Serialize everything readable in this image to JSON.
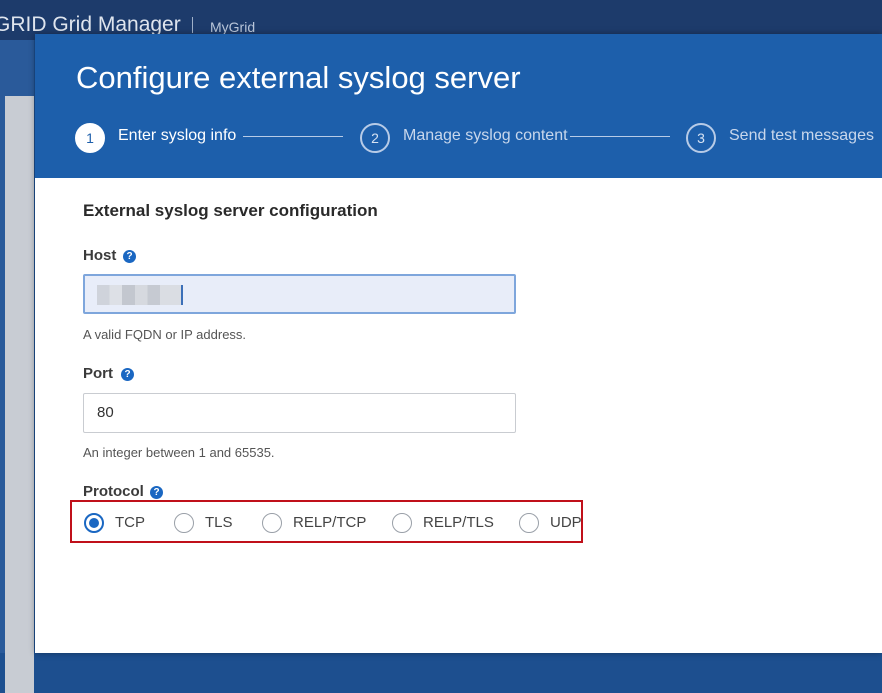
{
  "app": {
    "title": "GRID Grid Manager",
    "grid_name": "MyGrid"
  },
  "modal": {
    "title": "Configure external syslog server",
    "steps": [
      {
        "number": "1",
        "label": "Enter syslog info",
        "active": true
      },
      {
        "number": "2",
        "label": "Manage syslog content",
        "active": false
      },
      {
        "number": "3",
        "label": "Send test messages",
        "active": false
      }
    ]
  },
  "form": {
    "section_title": "External syslog server configuration",
    "host": {
      "label": "Host",
      "help_icon": "?",
      "value": "",
      "hint": "A valid FQDN or IP address."
    },
    "port": {
      "label": "Port",
      "help_icon": "?",
      "value": "80",
      "hint": "An integer between 1 and 65535."
    },
    "protocol": {
      "label": "Protocol",
      "help_icon": "?",
      "selected": "TCP",
      "options": [
        "TCP",
        "TLS",
        "RELP/TCP",
        "RELP/TLS",
        "UDP"
      ]
    }
  },
  "colors": {
    "header_blue": "#1d5fab",
    "accent": "#1a67c2",
    "highlight_box": "#c0101a"
  }
}
